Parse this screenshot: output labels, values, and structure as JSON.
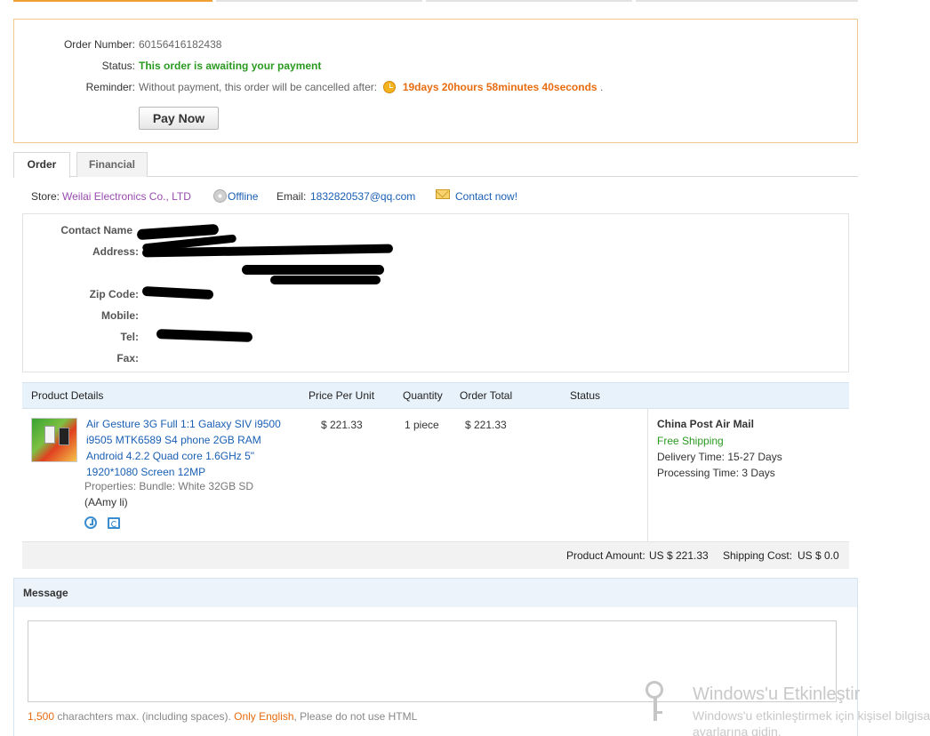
{
  "order": {
    "order_number_label": "Order Number:",
    "order_number": "60156416182438",
    "status_label": "Status:",
    "status": "This order is awaiting your payment",
    "reminder_label": "Reminder:",
    "reminder_text": "Without payment, this order will be cancelled after:",
    "countdown": "19days 20hours 58minutes 40seconds",
    "countdown_suffix": ".",
    "pay_now": "Pay Now"
  },
  "tabs": [
    {
      "label": "Order",
      "active": true
    },
    {
      "label": "Financial",
      "active": false
    }
  ],
  "store": {
    "store_label": "Store:",
    "store_name": "Weilai Electronics Co., LTD",
    "online_status": "Offline",
    "email_label": "Email:",
    "email": "1832820537@qq.com",
    "contact": "Contact now!"
  },
  "address": {
    "contact_name": "Contact Name",
    "address": "Address:",
    "zip": "Zip Code:",
    "mobile": "Mobile:",
    "tel": "Tel:",
    "fax": "Fax:"
  },
  "table": {
    "headers": {
      "product": "Product Details",
      "price": "Price Per Unit",
      "quantity": "Quantity",
      "total": "Order Total",
      "status": "Status"
    },
    "item": {
      "title": "Air Gesture 3G Full 1:1 Galaxy SIV i9500 i9505 MTK6589 S4 phone 2GB RAM Android 4.2.2 Quad core 1.6GHz 5\" 1920*1080 Screen 12MP",
      "properties": "Properties: Bundle: White 32GB SD",
      "buyer": "(AAmy li)",
      "price": "$ 221.33",
      "quantity": "1 piece",
      "total": "$ 221.33"
    },
    "shipping": {
      "method": "China Post Air Mail",
      "free": "Free Shipping",
      "delivery_label": "Delivery Time:",
      "delivery": "15-27 Days",
      "processing_label": "Processing Time:",
      "processing": "3 Days"
    }
  },
  "totals": {
    "product_amount_label": "Product Amount:",
    "product_amount": "US $ 221.33",
    "shipping_cost_label": "Shipping Cost:",
    "shipping_cost": "US $ 0.0"
  },
  "message": {
    "header": "Message",
    "limit": "1,500",
    "limit_text": " charachters max. (including spaces). ",
    "only_english": "Only English",
    "html_text": ", Please do not use HTML"
  },
  "watermark": {
    "title": "Windows'u Etkinleştir",
    "subtitle": "Windows'u etkinleştirmek için kişisel bilgisayar ayarlarına gidin."
  },
  "colors": {
    "accent_orange": "#e86c10",
    "status_green": "#2a9a20",
    "link_blue": "#1a5fb4",
    "price_red": "#cc2222",
    "store_purple": "#9a4bb0"
  }
}
